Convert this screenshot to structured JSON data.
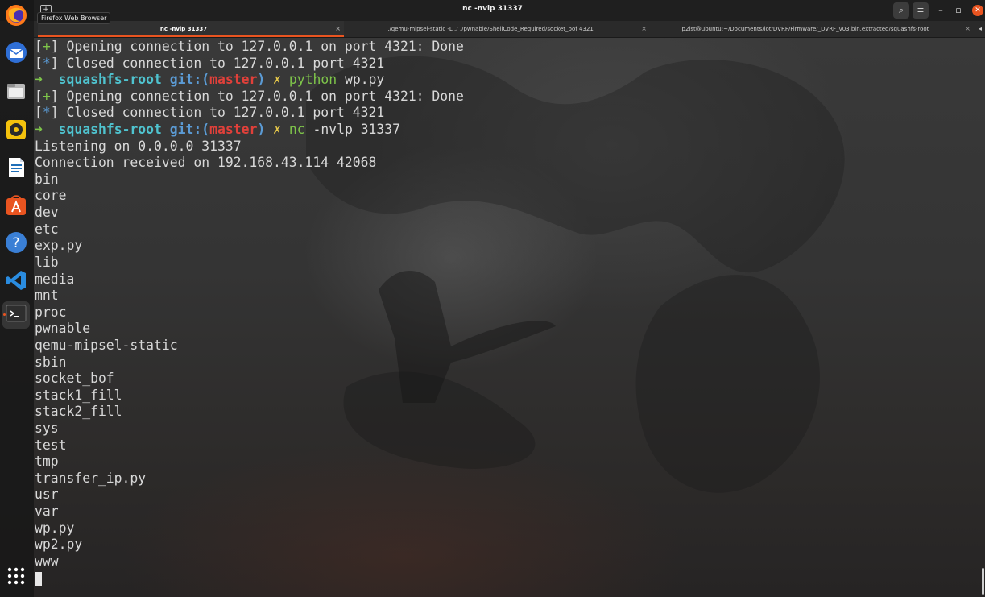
{
  "window": {
    "title": "nc -nvlp 31337",
    "tooltip": "Firefox Web Browser",
    "new_tab_glyph": "+",
    "search_glyph": "⌕",
    "menu_glyph": "≡",
    "minimize_glyph": "–",
    "maximize_glyph": "▫",
    "close_glyph": "✕"
  },
  "tabs": [
    {
      "label": "nc -nvlp 31337",
      "active": true
    },
    {
      "label": "./qemu-mipsel-static -L ./ ./pwnable/ShellCode_Required/socket_bof 4321",
      "active": false
    },
    {
      "label": "p2ist@ubuntu:~/Documents/iot/DVRF/Firmware/_DVRF_v03.bin.extracted/squashfs-root",
      "active": false
    }
  ],
  "tab_close_glyph": "×",
  "tab_scroll_glyph": "◂",
  "dock": [
    {
      "icon": "firefox-icon"
    },
    {
      "icon": "thunderbird-icon"
    },
    {
      "icon": "files-icon"
    },
    {
      "icon": "rhythmbox-icon"
    },
    {
      "icon": "libreoffice-writer-icon"
    },
    {
      "icon": "ubuntu-software-icon"
    },
    {
      "icon": "help-icon"
    },
    {
      "icon": "vscode-icon"
    },
    {
      "icon": "terminal-icon"
    },
    {
      "icon": "show-applications-icon"
    }
  ],
  "colors": {
    "accent": "#e95420",
    "prompt_arrow": "#7ec54a",
    "prompt_dir": "#4fc3cf",
    "git_label": "#5b9bd5",
    "branch": "#e0403a",
    "dirty_mark": "#e6c84a"
  },
  "terminal": {
    "status_lines": [
      {
        "mark": "+",
        "text": " Opening connection to 127.0.0.1 on port 4321: Done"
      },
      {
        "mark": "*",
        "text": " Closed connection to 127.0.0.1 port 4321"
      }
    ],
    "prompt1": {
      "arrow": "➜",
      "dir": "squashfs-root",
      "git": "git:(",
      "branch": "master",
      "git_close": ")",
      "dirty": "✗",
      "cmd": "python",
      "arg": "wp.py"
    },
    "status_lines2": [
      {
        "mark": "+",
        "text": " Opening connection to 127.0.0.1 on port 4321: Done"
      },
      {
        "mark": "*",
        "text": " Closed connection to 127.0.0.1 port 4321"
      }
    ],
    "prompt2": {
      "arrow": "➜",
      "dir": "squashfs-root",
      "git": "git:(",
      "branch": "master",
      "git_close": ")",
      "dirty": "✗",
      "cmd": "nc",
      "arg": "-nvlp 31337"
    },
    "output": [
      "Listening on 0.0.0.0 31337",
      "Connection received on 192.168.43.114 42068",
      "bin",
      "core",
      "dev",
      "etc",
      "exp.py",
      "lib",
      "media",
      "mnt",
      "proc",
      "pwnable",
      "qemu-mipsel-static",
      "sbin",
      "socket_bof",
      "stack1_fill",
      "stack2_fill",
      "sys",
      "test",
      "tmp",
      "transfer_ip.py",
      "usr",
      "var",
      "wp.py",
      "wp2.py",
      "www"
    ]
  }
}
